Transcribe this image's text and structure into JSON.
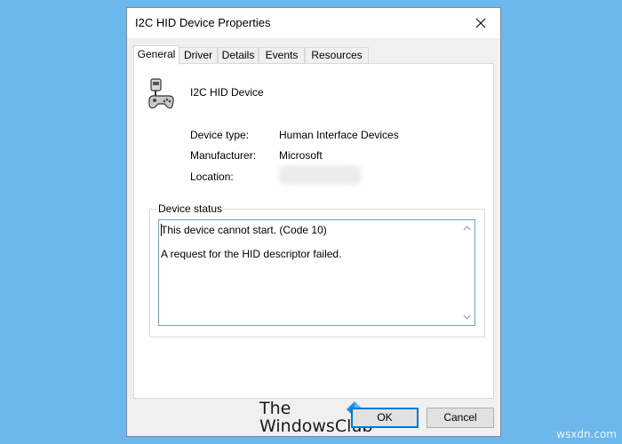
{
  "window": {
    "title": "I2C HID Device Properties"
  },
  "tabs": [
    {
      "label": "General",
      "active": true
    },
    {
      "label": "Driver"
    },
    {
      "label": "Details"
    },
    {
      "label": "Events"
    },
    {
      "label": "Resources"
    }
  ],
  "device": {
    "name": "I2C HID Device",
    "icon": "hid-device-icon",
    "properties": [
      {
        "label": "Device type:",
        "value": "Human Interface Devices"
      },
      {
        "label": "Manufacturer:",
        "value": "Microsoft"
      },
      {
        "label": "Location:",
        "value": ""
      }
    ]
  },
  "status": {
    "group_label": "Device status",
    "line1": "This device cannot start. (Code 10)",
    "line2": "A request for the HID descriptor failed."
  },
  "watermark": {
    "line1": "The",
    "line2": "WindowsClub"
  },
  "buttons": {
    "ok": "OK",
    "cancel": "Cancel"
  },
  "footer": {
    "credit": "wsxdn.com"
  },
  "colors": {
    "background": "#6cb8ec",
    "accent": "#0078d7",
    "watermark_logo": "#1e90e0"
  }
}
